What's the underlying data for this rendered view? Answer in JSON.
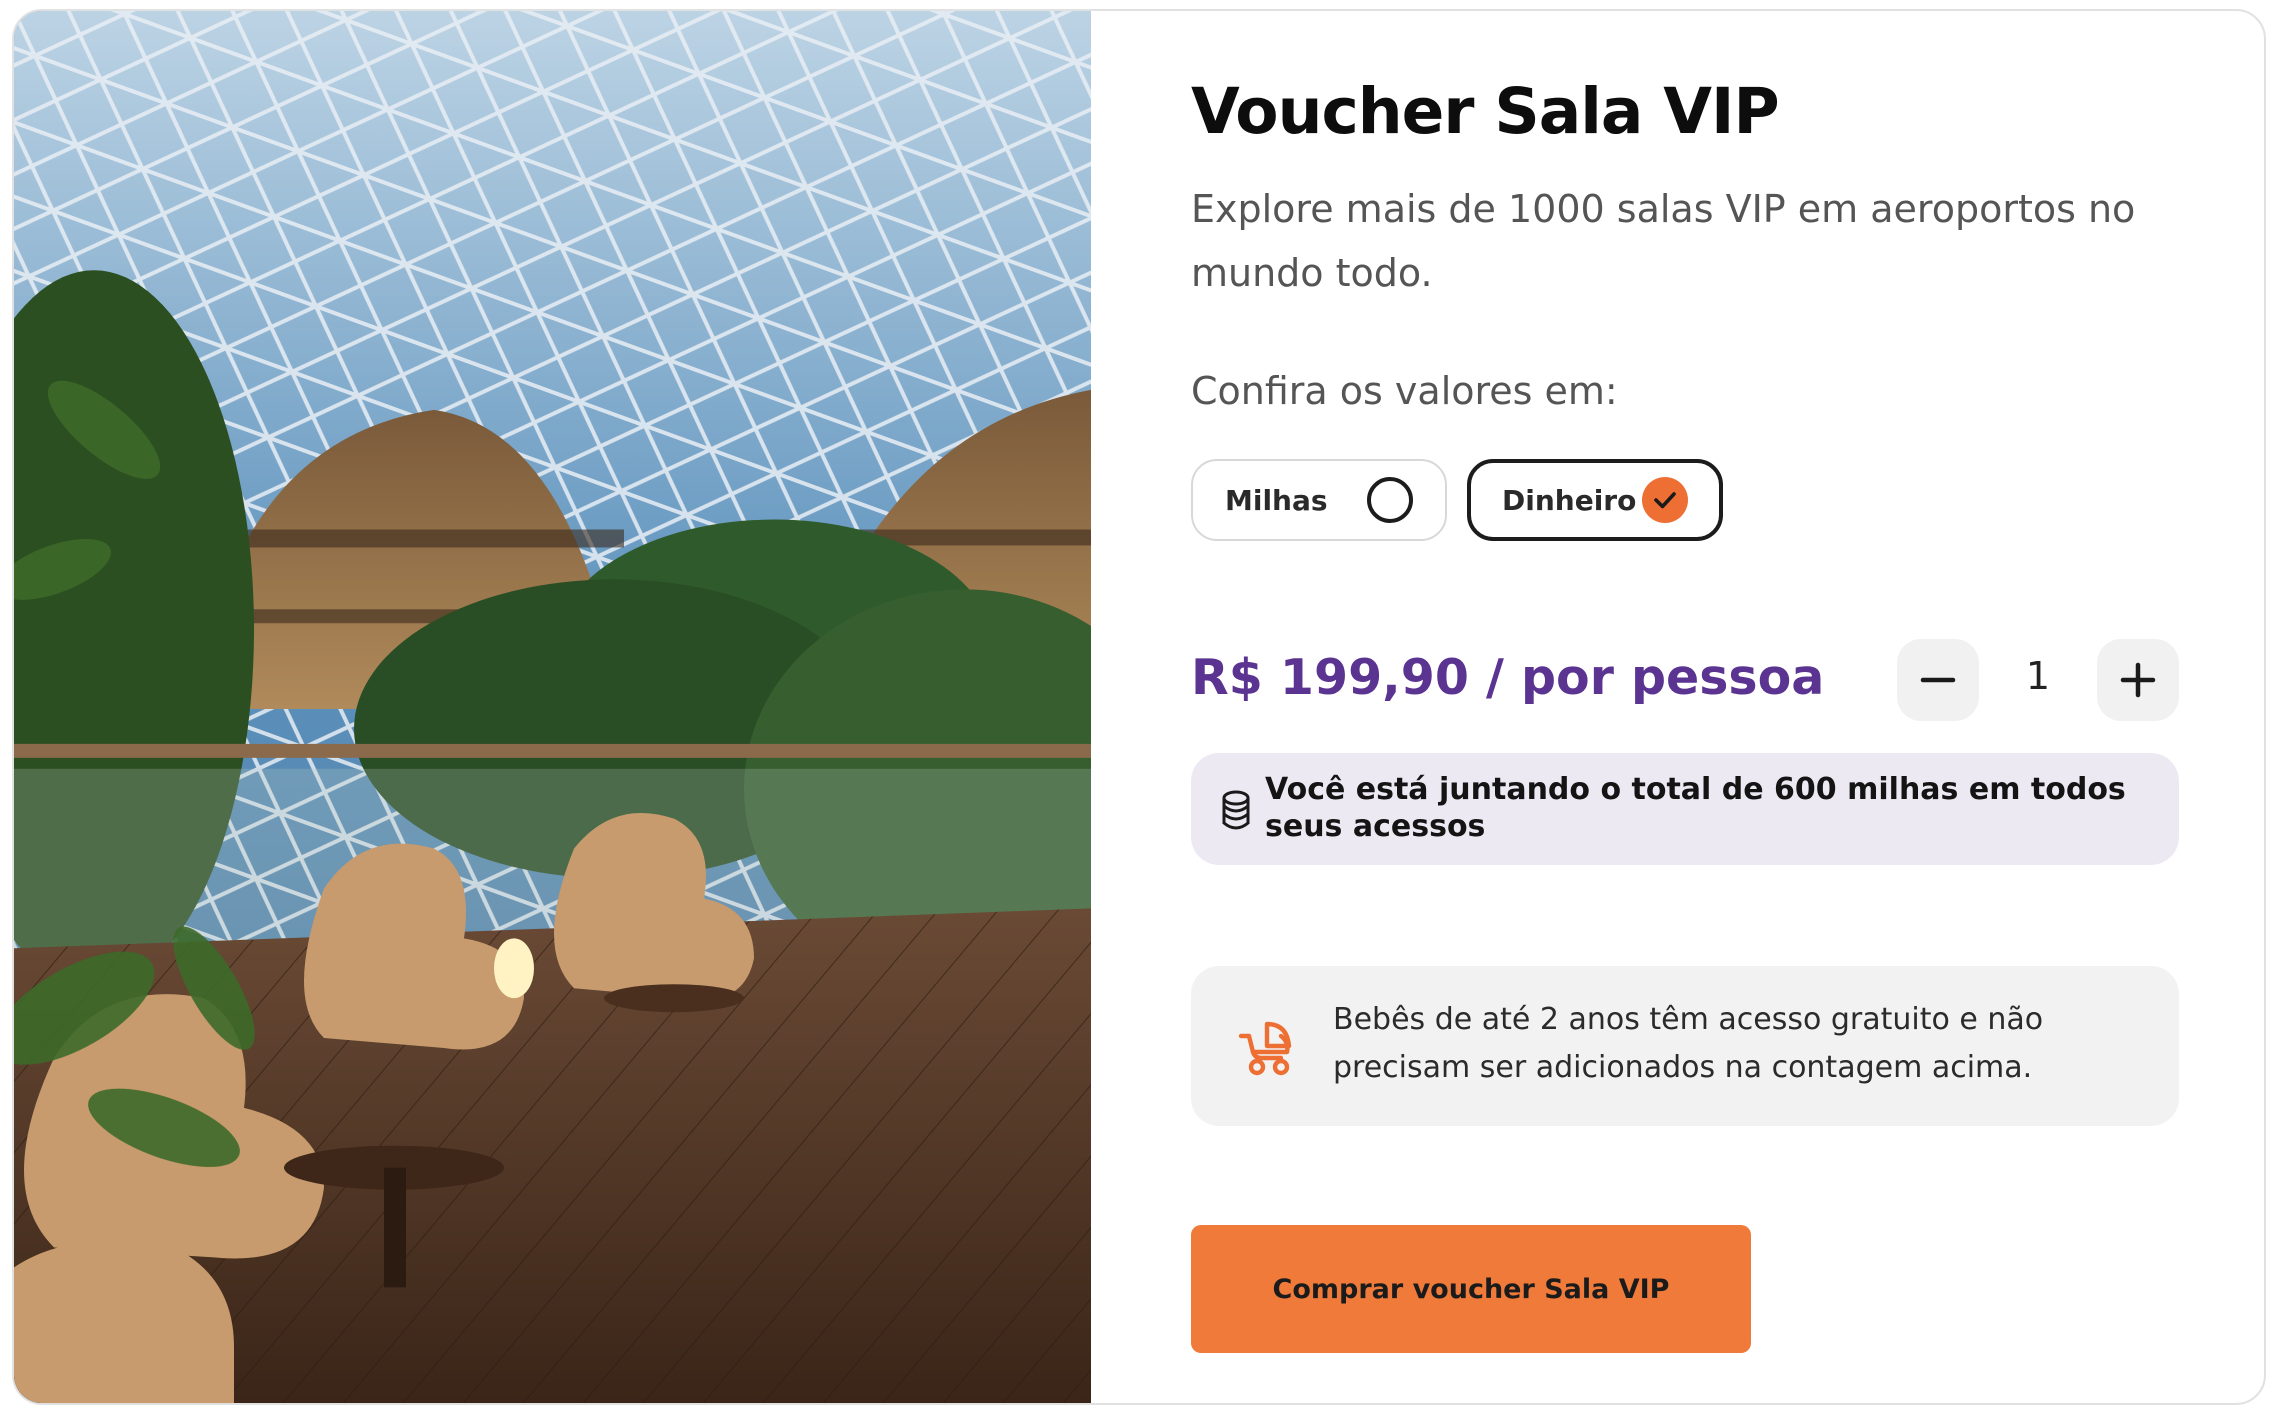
{
  "product": {
    "title": "Voucher Sala VIP",
    "subtitle": "Explore mais de 1000 salas VIP em aeroportos no mundo todo."
  },
  "currency_selector": {
    "prompt": "Confira os valores em:",
    "options": [
      {
        "label": "Milhas",
        "selected": false
      },
      {
        "label": "Dinheiro",
        "selected": true
      }
    ]
  },
  "pricing": {
    "price_text": "R$ 199,90 / por pessoa",
    "quantity": "1"
  },
  "miles_notice": {
    "icon": "coins-icon",
    "text": "Você está juntando o total de 600 milhas em todos seus acessos"
  },
  "baby_notice": {
    "icon": "stroller-icon",
    "text": "Bebês de até 2 anos têm acesso gratuito e não precisam ser adicionados na contagem acima."
  },
  "cta": {
    "label": "Comprar voucher Sala VIP"
  },
  "colors": {
    "accent": "#ED6F33",
    "price": "#5B3391",
    "miles_notice_bg": "#ECE9F3",
    "baby_notice_bg": "#F2F2F2",
    "cta_bg": "#EF7A3A"
  }
}
